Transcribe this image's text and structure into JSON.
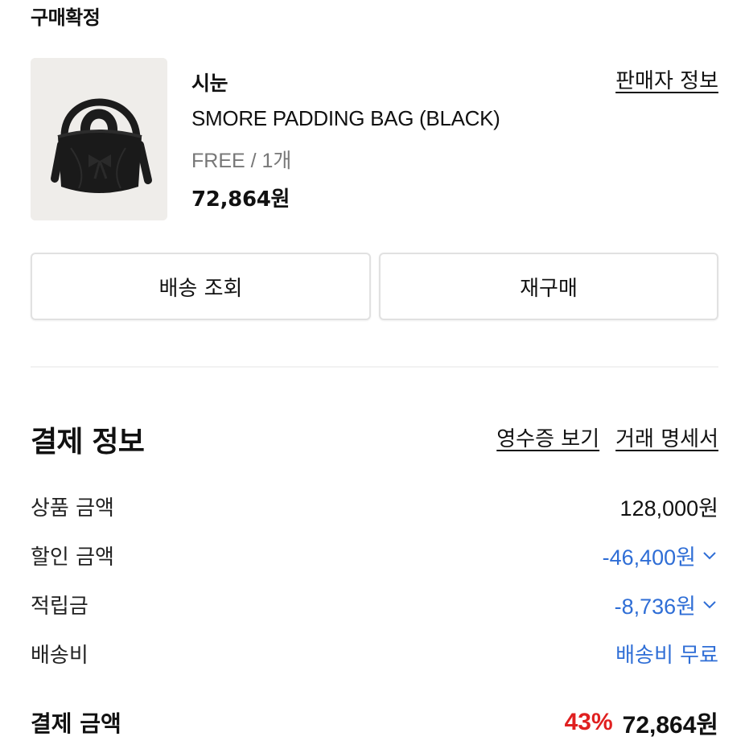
{
  "order": {
    "status": "구매확정",
    "seller_link": "판매자 정보"
  },
  "product": {
    "image_icon": "black-padded-bag-image",
    "brand": "시눈",
    "name": "SMORE PADDING BAG (BLACK)",
    "option": "FREE / 1개",
    "price": "72,864원"
  },
  "actions": {
    "shipping_label": "배송 조회",
    "rebuy_label": "재구매"
  },
  "payment": {
    "title": "결제 정보",
    "receipt_link": "영수증 보기",
    "statement_link": "거래 명세서",
    "rows": [
      {
        "label": "상품 금액",
        "value": "128,000원"
      },
      {
        "label": "할인 금액",
        "value": "-46,400원",
        "color": "#2f6ed6",
        "expandable": true
      },
      {
        "label": "적립금",
        "value": "-8,736원",
        "color": "#2f6ed6",
        "expandable": true
      },
      {
        "label": "배송비",
        "value": "배송비 무료",
        "color": "#2f6ed6"
      }
    ],
    "total": {
      "label": "결제 금액",
      "discount_pct": "43%",
      "discount_color": "#e02020",
      "amount": "72,864원"
    }
  }
}
